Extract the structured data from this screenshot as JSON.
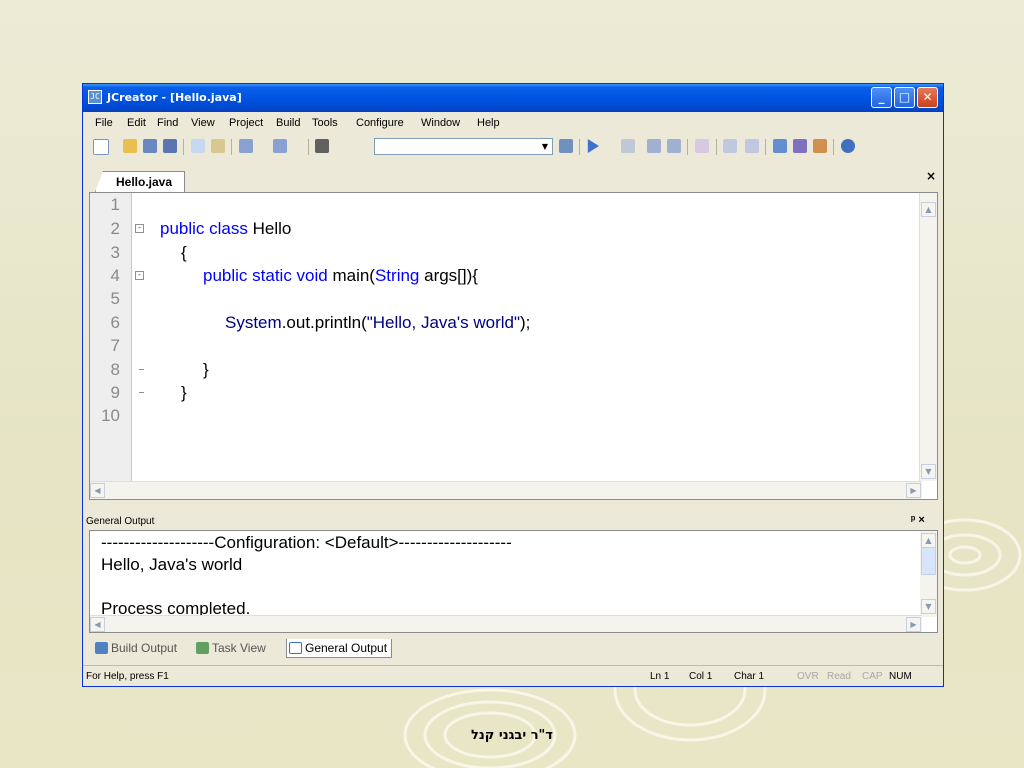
{
  "window": {
    "title": "JCreator - [Hello.java]",
    "app_icon": "JC"
  },
  "menu": [
    "File",
    "Edit",
    "Find",
    "View",
    "Project",
    "Build",
    "Tools",
    "Configure",
    "Window",
    "Help"
  ],
  "doc_tab": {
    "label": "Hello.java",
    "close": "×"
  },
  "editor": {
    "line_numbers": [
      "1",
      "2",
      "3",
      "4",
      "5",
      "6",
      "7",
      "8",
      "9",
      "10"
    ],
    "lines": {
      "l2_kw": "public class",
      "l2_txt": " Hello",
      "l3": "{",
      "l4_kw": "public static void",
      "l4_txt": " main(",
      "l4_kw2": "String",
      "l4_txt2": " args[]){",
      "l6_kw": "System",
      "l6_txt": ".out.println(",
      "l6_str": "\"Hello, Java's world\"",
      "l6_end": ");",
      "l8": "}",
      "l9": "}"
    }
  },
  "output_panel": {
    "title": "General Output",
    "controls": "ᵖ ×",
    "lines": [
      "--------------------Configuration: <Default>--------------------",
      "Hello, Java's world",
      "",
      "Process completed."
    ]
  },
  "bottom_tabs": [
    "Build Output",
    "Task View",
    "General Output"
  ],
  "status": {
    "help": "For Help, press F1",
    "ln": "Ln 1",
    "col": "Col 1",
    "char": "Char 1",
    "ovr": "OVR",
    "read": "Read",
    "cap": "CAP",
    "num": "NUM"
  },
  "footer": "ד\"ר יבגני קנל",
  "colors": {
    "titlebar": "#0054e3",
    "keyword": "#0000ff",
    "string": "#000080",
    "background": "#e8e6c8"
  }
}
